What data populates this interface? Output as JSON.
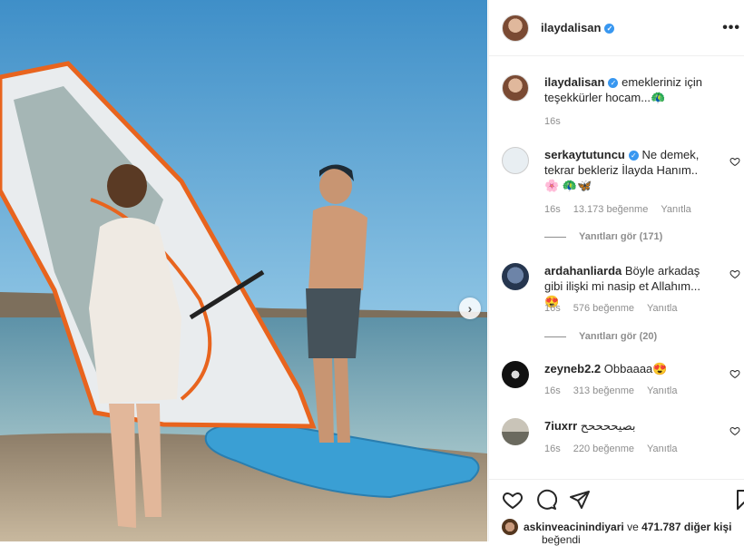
{
  "post": {
    "author": "ilaydalisan",
    "more_label": "•••"
  },
  "comments": [
    {
      "user": "ilaydalisan",
      "text": "emekleriniz için teşekkürler hocam...🦚",
      "time": "16s"
    },
    {
      "user": "serkaytutuncu",
      "text": "Ne demek, tekrar bekleriz İlayda Hanım.. 🌸 🦚🦋",
      "time": "16s",
      "likes": "13.173 beğenme",
      "reply": "Yanıtla",
      "view_replies": "Yanıtları gör (171)"
    },
    {
      "user": "ardahanliarda",
      "text": "Böyle arkadaş gibi ilişki mi nasip et Allahım...😍",
      "time": "16s",
      "likes": "576 beğenme",
      "reply": "Yanıtla",
      "view_replies": "Yanıtları gör (20)"
    },
    {
      "user": "zeyneb2.2",
      "text": "Obbaaaa😍",
      "time": "16s",
      "likes": "313 beğenme",
      "reply": "Yanıtla"
    },
    {
      "user": "7iuxrr",
      "text": "بصيححححح",
      "time": "16s",
      "likes": "220 beğenme",
      "reply": "Yanıtla"
    }
  ],
  "liked_by": {
    "user": "askinveacinindiyari",
    "connector": "ve",
    "others": "471.787 diğer kişi",
    "suffix": "beğendi"
  },
  "icons": [
    "heart-icon",
    "comment-icon",
    "share-icon",
    "bookmark-icon",
    "chevron-right-icon",
    "verified-icon"
  ]
}
